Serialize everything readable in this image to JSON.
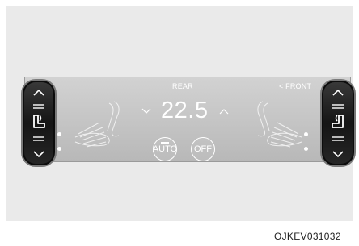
{
  "panel": {
    "rear_label": "REAR",
    "front_label": "< FRONT",
    "temperature": "22.5",
    "auto_label": "AUTO",
    "off_label": "OFF"
  },
  "left_control": {
    "up_icon": "chevron-up-icon",
    "seat_icon": "heated-seat-icon",
    "down_icon": "chevron-down-icon"
  },
  "right_control": {
    "up_icon": "chevron-up-icon",
    "seat_icon": "heated-seat-icon",
    "down_icon": "chevron-down-icon"
  },
  "figure_code": "OJKEV031032",
  "colors": {
    "panel": "#c8c8c8",
    "text": "#ffffff",
    "pill": "#1a1a1a"
  }
}
